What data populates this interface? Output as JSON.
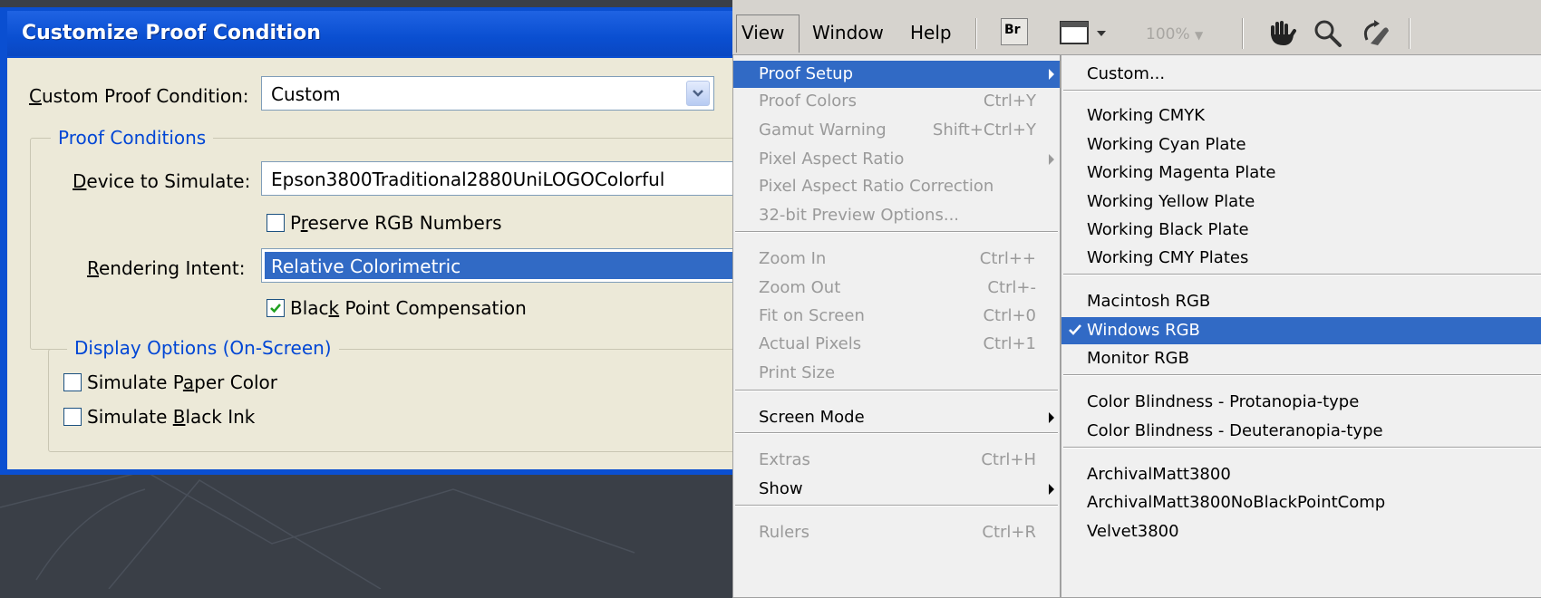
{
  "dialog": {
    "title": "Customize Proof Condition",
    "custom_condition_label_u": "C",
    "custom_condition_label_rest": "ustom Proof Condition:",
    "custom_condition_value": "Custom",
    "proof_conditions_group": "Proof Conditions",
    "device_label_u": "D",
    "device_label_rest": "evice to Simulate:",
    "device_value": "Epson3800Traditional2880UniLOGOColorful",
    "preserve_rgb_pre": "P",
    "preserve_rgb_u": "r",
    "preserve_rgb_post": "eserve RGB Numbers",
    "preserve_rgb_checked": false,
    "rendering_label_u": "R",
    "rendering_label_rest": "endering Intent:",
    "rendering_value": "Relative Colorimetric",
    "black_point_pre": "Blac",
    "black_point_u": "k",
    "black_point_post": " Point Compensation",
    "black_point_checked": true,
    "display_options_group": "Display Options (On-Screen)",
    "paper_color_pre": "Simulate P",
    "paper_color_u": "a",
    "paper_color_post": "per Color",
    "paper_color_checked": false,
    "black_ink_pre": "Simulate ",
    "black_ink_u": "B",
    "black_ink_post": "lack Ink",
    "black_ink_checked": false
  },
  "menubar": {
    "view": "View",
    "window": "Window",
    "help": "Help",
    "br": "Br",
    "zoom": "100%",
    "icons": [
      "bridge-icon",
      "screen-mode-icon",
      "hand-icon",
      "zoom-icon",
      "rotate-view-icon"
    ]
  },
  "view_menu": [
    {
      "label": "Proof Setup",
      "shortcut": "",
      "enabled": true,
      "highlighted": true,
      "submenu": true
    },
    {
      "label": "Proof Colors",
      "shortcut": "Ctrl+Y",
      "enabled": false
    },
    {
      "label": "Gamut Warning",
      "shortcut": "Shift+Ctrl+Y",
      "enabled": false
    },
    {
      "label": "Pixel Aspect Ratio",
      "shortcut": "",
      "enabled": false,
      "submenu": true
    },
    {
      "label": "Pixel Aspect Ratio Correction",
      "shortcut": "",
      "enabled": false
    },
    {
      "label": "32-bit Preview Options...",
      "shortcut": "",
      "enabled": false
    },
    {
      "label": "Zoom In",
      "shortcut": "Ctrl++",
      "enabled": false
    },
    {
      "label": "Zoom Out",
      "shortcut": "Ctrl+-",
      "enabled": false
    },
    {
      "label": "Fit on Screen",
      "shortcut": "Ctrl+0",
      "enabled": false
    },
    {
      "label": "Actual Pixels",
      "shortcut": "Ctrl+1",
      "enabled": false
    },
    {
      "label": "Print Size",
      "shortcut": "",
      "enabled": false
    },
    {
      "label": "Screen Mode",
      "shortcut": "",
      "enabled": true,
      "submenu": true
    },
    {
      "label": "Extras",
      "shortcut": "Ctrl+H",
      "enabled": false
    },
    {
      "label": "Show",
      "shortcut": "",
      "enabled": true,
      "submenu": true
    },
    {
      "label": "Rulers",
      "shortcut": "Ctrl+R",
      "enabled": false
    }
  ],
  "proof_setup_submenu": [
    {
      "label": "Custom..."
    },
    {
      "label": "Working CMYK"
    },
    {
      "label": "Working Cyan Plate"
    },
    {
      "label": "Working Magenta Plate"
    },
    {
      "label": "Working Yellow Plate"
    },
    {
      "label": "Working Black Plate"
    },
    {
      "label": "Working CMY Plates"
    },
    {
      "label": "Macintosh RGB"
    },
    {
      "label": "Windows RGB",
      "checked": true,
      "highlighted": true
    },
    {
      "label": "Monitor RGB"
    },
    {
      "label": "Color Blindness - Protanopia-type"
    },
    {
      "label": "Color Blindness - Deuteranopia-type"
    },
    {
      "label": "ArchivalMatt3800"
    },
    {
      "label": "ArchivalMatt3800NoBlackPointComp"
    },
    {
      "label": "Velvet3800"
    }
  ],
  "colors": {
    "title_bar": "#0a4fd1",
    "dialog_bg": "#ece9d8",
    "selection": "#316ac5",
    "group_label": "#0046d5",
    "menu_bg": "#f0f0f0",
    "disabled_text": "#9a9a9a",
    "desktop_bg": "#3a3f47"
  }
}
